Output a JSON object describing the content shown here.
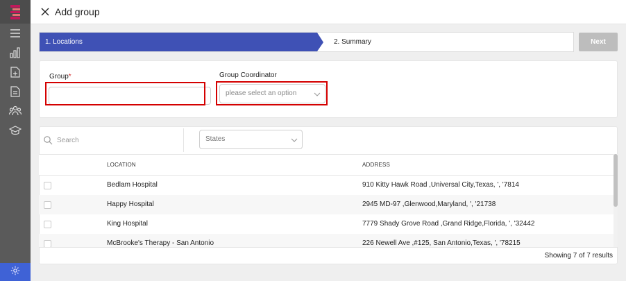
{
  "header": {
    "title": "Add group"
  },
  "stepper": {
    "steps": [
      {
        "label": "1. Locations"
      },
      {
        "label": "2. Summary"
      }
    ],
    "next_label": "Next"
  },
  "form": {
    "group_label": "Group",
    "required_mark": "*",
    "group_value": "",
    "coordinator_label": "Group Coordinator",
    "coordinator_placeholder": "please select an option"
  },
  "filters": {
    "search_placeholder": "Search",
    "states_placeholder": "States"
  },
  "table": {
    "columns": [
      "LOCATION",
      "ADDRESS"
    ],
    "rows": [
      {
        "location": "Bedlam Hospital",
        "address": "910 Kitty Hawk Road ,Universal City,Texas, ', '7814"
      },
      {
        "location": "Happy Hospital",
        "address": "2945 MD-97 ,Glenwood,Maryland, ', '21738"
      },
      {
        "location": "King Hospital",
        "address": "7779 Shady Grove Road ,Grand Ridge,Florida, ', '32442"
      },
      {
        "location": "McBrooke's Therapy - San Antonio",
        "address": "226 Newell Ave ,#125, San Antonio,Texas, ', '78215"
      }
    ],
    "footer_text": "Showing 7 of 7 results"
  },
  "icons": {
    "logo": "brand-logo-icon",
    "sidebar": [
      "menu-icon",
      "chart-icon",
      "document-add-icon",
      "document-list-icon",
      "group-icon",
      "graduation-cap-icon",
      "gear-icon"
    ]
  },
  "colors": {
    "accent": "#3f51b5",
    "sidebar": "#5a5a5a",
    "highlight": "#d40000",
    "logo": "#c2185b"
  }
}
